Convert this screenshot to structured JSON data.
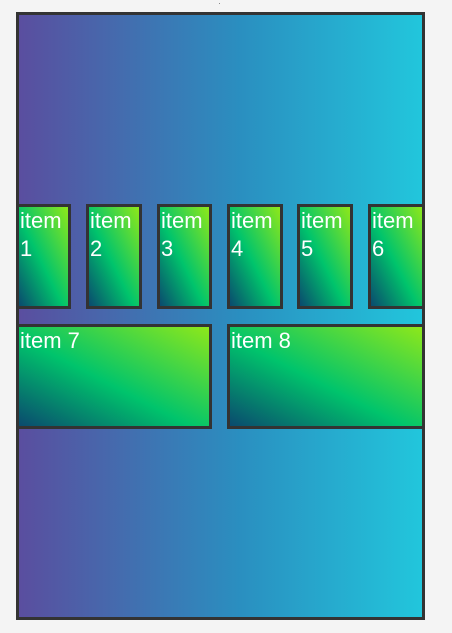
{
  "items": [
    {
      "label": "item 1"
    },
    {
      "label": "item 2"
    },
    {
      "label": "item 3"
    },
    {
      "label": "item 4"
    },
    {
      "label": "item 5"
    },
    {
      "label": "item 6"
    },
    {
      "label": "item 7"
    },
    {
      "label": "item 8"
    }
  ]
}
